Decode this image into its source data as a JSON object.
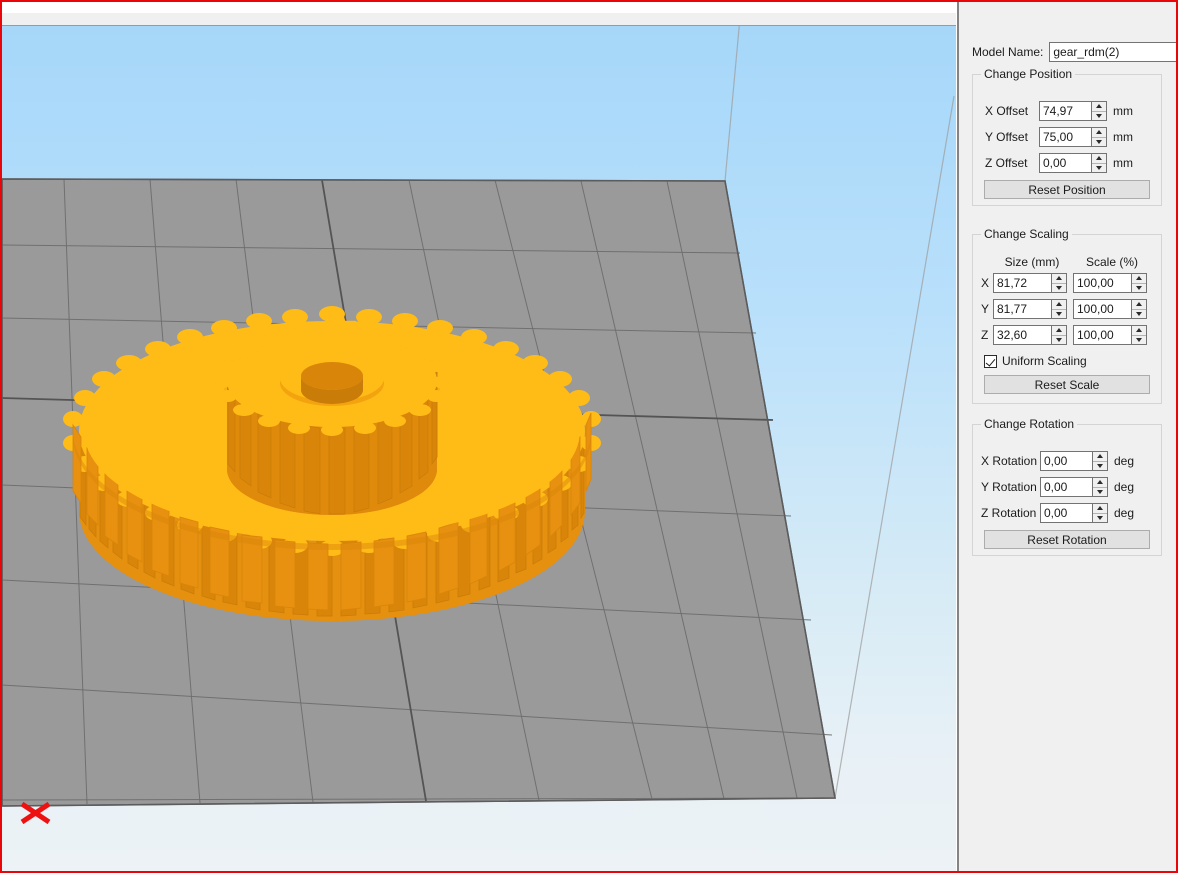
{
  "window": {
    "accent_border_color": "#e8060a",
    "panel_background": "#f0f0f0"
  },
  "viewport": {
    "name": "3d-print-preview",
    "background_top_color": "#a6d7f9",
    "background_bottom_color": "#ecf2f6",
    "buildplate_color": "#9a9a9a",
    "buildplate_grid_color": "#6e6e6e",
    "origin_marker_color": "#ee1111",
    "model": {
      "name": "gear_rdm(2)",
      "body_color": "#ffbb16",
      "side_color": "#e8900f",
      "shadow_color": "#d9890b",
      "large_gear_teeth": 44,
      "small_gear_teeth": 18
    }
  },
  "panel": {
    "model_name": {
      "label": "Model Name:",
      "value": "gear_rdm(2)",
      "placeholder": ""
    },
    "position": {
      "title": "Change Position",
      "rows": [
        {
          "label": "X Offset",
          "value": "74,97",
          "unit": "mm"
        },
        {
          "label": "Y Offset",
          "value": "75,00",
          "unit": "mm"
        },
        {
          "label": "Z Offset",
          "value": "0,00",
          "unit": "mm"
        }
      ],
      "reset_label": "Reset Position"
    },
    "scaling": {
      "title": "Change Scaling",
      "headers": {
        "size": "Size (mm)",
        "scale": "Scale (%)"
      },
      "rows": [
        {
          "axis": "X",
          "size": "81,72",
          "scale": "100,00"
        },
        {
          "axis": "Y",
          "size": "81,77",
          "scale": "100,00"
        },
        {
          "axis": "Z",
          "size": "32,60",
          "scale": "100,00"
        }
      ],
      "uniform_label": "Uniform Scaling",
      "uniform_checked": true,
      "reset_label": "Reset Scale"
    },
    "rotation": {
      "title": "Change Rotation",
      "rows": [
        {
          "label": "X Rotation",
          "value": "0,00",
          "unit": "deg"
        },
        {
          "label": "Y Rotation",
          "value": "0,00",
          "unit": "deg"
        },
        {
          "label": "Z Rotation",
          "value": "0,00",
          "unit": "deg"
        }
      ],
      "reset_label": "Reset Rotation"
    }
  }
}
